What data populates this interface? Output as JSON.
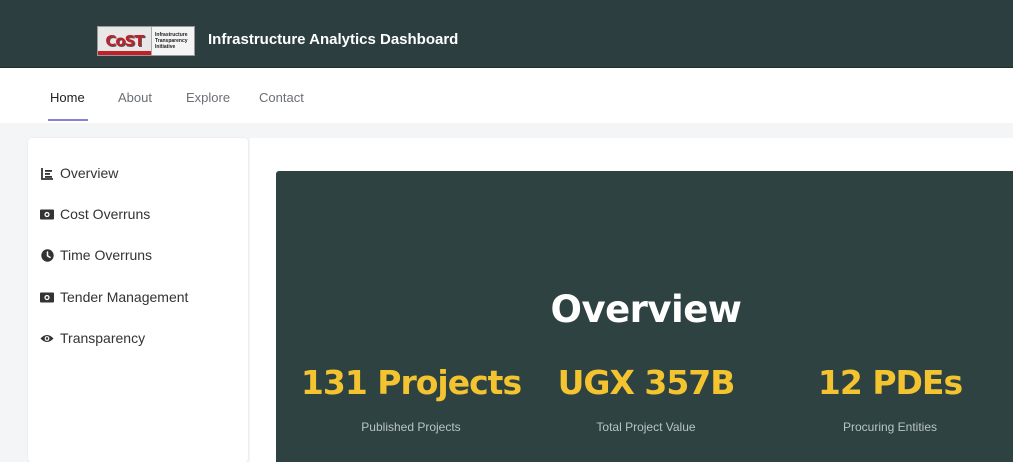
{
  "header": {
    "logo_mark": "CoST",
    "logo_lines": [
      "Infrastructure",
      "Transparency",
      "Initiative"
    ],
    "title": "Infrastructure Analytics Dashboard"
  },
  "nav": {
    "items": [
      {
        "label": "Home",
        "active": true
      },
      {
        "label": "About",
        "active": false
      },
      {
        "label": "Explore",
        "active": false
      },
      {
        "label": "Contact",
        "active": false
      }
    ]
  },
  "sidebar": {
    "items": [
      {
        "label": "Overview",
        "icon": "bar-chart-icon"
      },
      {
        "label": "Cost Overruns",
        "icon": "money-bill-icon"
      },
      {
        "label": "Time Overruns",
        "icon": "clock-icon"
      },
      {
        "label": "Tender Management",
        "icon": "money-bill-icon"
      },
      {
        "label": "Transparency",
        "icon": "eye-icon"
      }
    ]
  },
  "overview": {
    "title": "Overview",
    "stats": [
      {
        "value": "131 Projects",
        "label": "Published Projects"
      },
      {
        "value": "UGX 357B",
        "label": "Total Project Value"
      },
      {
        "value": "12 PDEs",
        "label": "Procuring Entities"
      }
    ]
  },
  "colors": {
    "header_bg": "#2c3e3f",
    "panel_bg": "#2e4242",
    "stat_accent": "#f4c430",
    "nav_underline": "#8a7fd6"
  }
}
